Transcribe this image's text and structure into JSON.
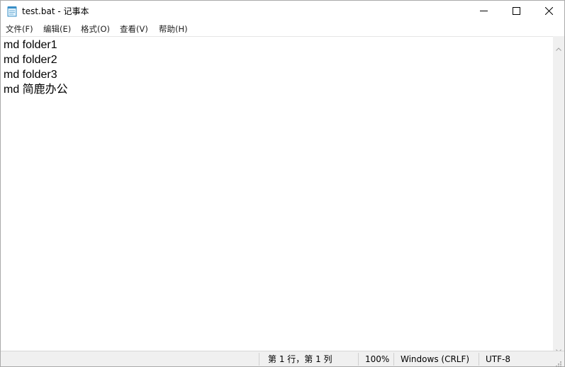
{
  "window": {
    "title": "test.bat - 记事本",
    "icon": "notepad-icon",
    "controls": [
      "minimize-icon",
      "maximize-icon",
      "close-icon"
    ]
  },
  "menu": {
    "file": "文件(F)",
    "edit": "编辑(E)",
    "format": "格式(O)",
    "view": "查看(V)",
    "help": "帮助(H)"
  },
  "editor": {
    "lines": [
      "md folder1",
      "md folder2",
      "md folder3",
      "md 简鹿办公"
    ]
  },
  "status": {
    "position": "第 1 行，第 1 列",
    "zoom": "100%",
    "line_ending": "Windows (CRLF)",
    "encoding": "UTF-8"
  }
}
